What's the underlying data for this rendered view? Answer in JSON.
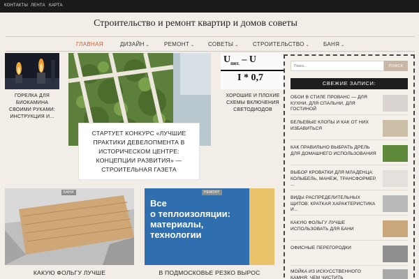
{
  "topbar": {
    "links": [
      "КОНТАКТЫ",
      "ЛЕНТА",
      "КАРТА"
    ]
  },
  "site": {
    "title": "Строительство и ремонт квартир и домов советы"
  },
  "nav": {
    "items": [
      {
        "label": "ГЛАВНАЯ",
        "active": true,
        "dropdown": false
      },
      {
        "label": "ДИЗАЙН",
        "active": false,
        "dropdown": true
      },
      {
        "label": "РЕМОНТ",
        "active": false,
        "dropdown": true
      },
      {
        "label": "СОВЕТЫ",
        "active": false,
        "dropdown": true
      },
      {
        "label": "СТРОИТЕЛЬСТВО",
        "active": false,
        "dropdown": true
      },
      {
        "label": "БАНЯ",
        "active": false,
        "dropdown": true
      }
    ],
    "chevron": "⌄"
  },
  "cards": {
    "left": {
      "title": "ГОРЕЛКА ДЛЯ БИОКАМИНА СВОИМИ РУКАМИ: ИНСТРУКЦИЯ И..."
    },
    "feature": {
      "title": "СТАРТУЕТ КОНКУРС «ЛУЧШИЕ ПРАКТИКИ ДЕВЕЛОПМЕНТА В ИСТОРИЧЕСКОМ ЦЕНТРЕ: КОНЦЕПЦИИ РАЗВИТИЯ» — СТРОИТЕЛЬНАЯ ГАЗЕТА"
    },
    "right": {
      "title": "ХОРОШИЕ И ПЛОХИЕ СХЕМЫ ВКЛЮЧЕНИЯ СВЕТОДИОДОВ",
      "formula_top": "U",
      "formula_sub": "пит.",
      "formula_tail": "– U",
      "formula_bottom": "I * 0,7"
    },
    "bottom_left": {
      "badge": "БАНИ",
      "title": "КАКУЮ ФОЛЬГУ ЛУЧШЕ"
    },
    "bottom_mid": {
      "badge": "РЕМОНТ",
      "title": "В ПОДМОСКОВЬЕ РЕЗКО ВЫРОС",
      "image_text": [
        "Все",
        "о теплоизоляции:",
        "материалы,",
        "технологии"
      ]
    }
  },
  "sidebar": {
    "search_placeholder": "Поиск...",
    "search_button": "ПОИСК",
    "recent_title": "СВЕЖИЕ ЗАПИСИ:",
    "posts": [
      {
        "title": "ОБОИ В СТИЛЕ ПРОВАНС — ДЛЯ КУХНИ, ДЛЯ СПАЛЬНИ, ДЛЯ ГОСТИНОЙ",
        "thumb": "#d9d4cf"
      },
      {
        "title": "БЕЛЬЕВЫЕ КЛОПЫ И КАК ОТ НИХ ИЗБАВИТЬСЯ",
        "thumb": "#cbbfa8"
      },
      {
        "title": "КАК ПРАВИЛЬНО ВЫБРАТЬ ДРЕЛЬ ДЛЯ ДОМАШНЕГО ИСПОЛЬЗОВАНИЯ",
        "thumb": "#5f8a3c"
      },
      {
        "title": "ВЫБОР КРОВАТКИ ДЛЯ МЛАДЕНЦА: КОЛЫБЕЛЬ, МАНЕЖ, ТРАНСФОРМЕР, ...",
        "thumb": "#e4e1dc"
      },
      {
        "title": "ВИДЫ РАСПРЕДЕЛИТЕЛЬНЫХ ЩИТОВ: КРАТКАЯ ХАРАКТЕРИСТИКА И...",
        "thumb": "#b9b9b9"
      },
      {
        "title": "КАКУЮ ФОЛЬГУ ЛУЧШЕ ИСПОЛЬЗОВАТЬ ДЛЯ БАНИ",
        "thumb": "#c9a77a"
      },
      {
        "title": "ОФИСНЫЕ ПЕРЕГОРОДКИ",
        "thumb": "#8f8f8f"
      },
      {
        "title": "МОЙКА ИЗ ИСКУССТВЕННОГО КАМНЯ: ЧЕМ ЧИСТИТЬ",
        "thumb": "#a9a9a9"
      }
    ]
  },
  "colors": {
    "accent": "#c7603a",
    "topbar": "#1b1b1b",
    "background": "#f2ede6",
    "badge": "#8c8c8c"
  }
}
